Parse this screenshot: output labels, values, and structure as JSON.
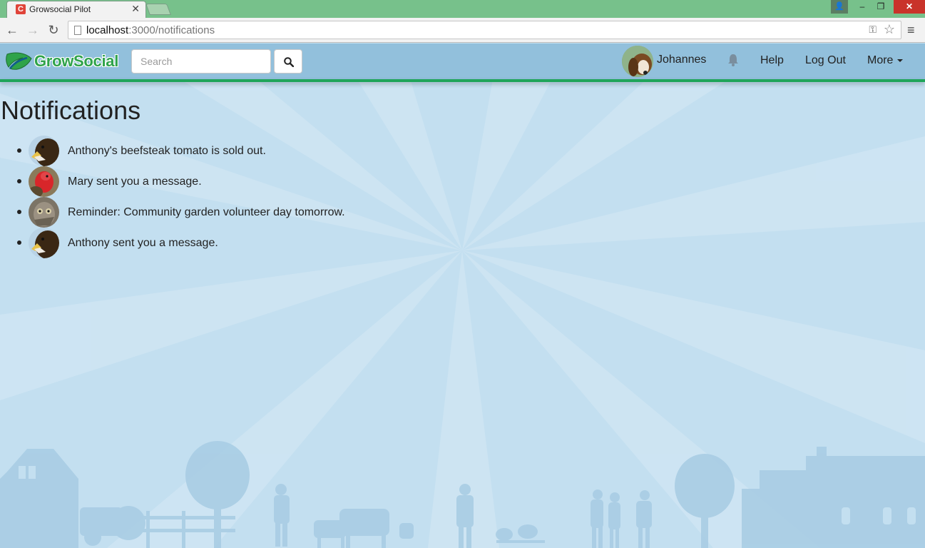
{
  "browser": {
    "tab_title": "Growsocial Pilot",
    "tab_favicon_letter": "C",
    "url_host": "localhost",
    "url_path": ":3000/notifications"
  },
  "navbar": {
    "logo_text": "GrowSocial",
    "search_placeholder": "Search",
    "user_name": "Johannes",
    "links": {
      "help": "Help",
      "logout": "Log Out",
      "more": "More"
    }
  },
  "main": {
    "title": "Notifications",
    "notifications": [
      {
        "text": "Anthony's beefsteak tomato is sold out.",
        "avatar": "eagle-avatar"
      },
      {
        "text": "Mary sent you a message.",
        "avatar": "turkey-avatar"
      },
      {
        "text": "Reminder: Community garden volunteer day tomorrow.",
        "avatar": "owl-avatar"
      },
      {
        "text": "Anthony sent you a message.",
        "avatar": "eagle-avatar"
      }
    ]
  },
  "colors": {
    "navbar": "#92c0dc",
    "accent": "#1fa55a",
    "background": "#c3dff0"
  }
}
